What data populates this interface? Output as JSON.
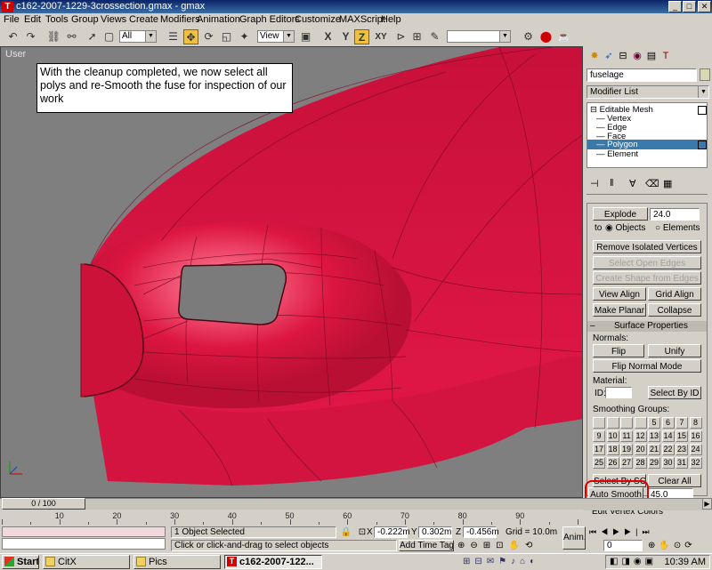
{
  "window": {
    "title": "c162-2007-1229-3crossection.gmax - gmax",
    "minimize": "_",
    "maximize": "□",
    "close": "✕"
  },
  "menu": [
    "File",
    "Edit",
    "Tools",
    "Group",
    "Views",
    "Create",
    "Modifiers",
    "Animation",
    "Graph Editors",
    "Customize",
    "MAXScript",
    "Help"
  ],
  "toolbar": {
    "selection_filter": "All",
    "ref_coord": "View",
    "axis_x": "X",
    "axis_y": "Y",
    "axis_z": "Z",
    "axis_xy": "XY"
  },
  "viewport": {
    "label": "User",
    "caption": "With the cleanup completed, we now select all polys and re-Smooth the fuse for inspection of our work",
    "model_color": "#e0163c"
  },
  "command_panel": {
    "object_name": "fuselage",
    "modifier_list": "Modifier List",
    "stack": {
      "root": "Editable Mesh",
      "items": [
        "Vertex",
        "Edge",
        "Face",
        "Polygon",
        "Element"
      ],
      "selected": "Polygon"
    },
    "explode_label": "Explode",
    "explode_value": "24.0",
    "to_label": "to",
    "objects_label": "Objects",
    "elements_label": "Elements",
    "remove_isolated": "Remove Isolated Vertices",
    "select_open_edges": "Select Open Edges",
    "create_shape": "Create Shape from Edges",
    "view_align": "View Align",
    "grid_align": "Grid Align",
    "make_planar": "Make Planar",
    "collapse": "Collapse",
    "surface_properties": "Surface Properties",
    "surface_collapse_sign": "–",
    "normals_label": "Normals:",
    "flip": "Flip",
    "unify": "Unify",
    "flip_normal_mode": "Flip Normal Mode",
    "material_label": "Material:",
    "id_label": "ID:",
    "select_by_id": "Select By ID",
    "smoothing_groups_label": "Smoothing Groups:",
    "smoothing_groups": [
      "",
      "",
      "",
      "",
      "5",
      "6",
      "7",
      "8",
      "9",
      "10",
      "11",
      "12",
      "13",
      "14",
      "15",
      "16",
      "17",
      "18",
      "19",
      "20",
      "21",
      "22",
      "23",
      "24",
      "25",
      "26",
      "27",
      "28",
      "29",
      "30",
      "31",
      "32"
    ],
    "select_by_sg": "Select By SG",
    "clear_all": "Clear All",
    "auto_smooth": "Auto Smooth",
    "auto_smooth_value": "45.0",
    "edit_vertex_colors": "Edit Vertex Colors",
    "highlight_color": "#e00000"
  },
  "timeline": {
    "frame": "0 / 100",
    "ticks": [
      "10",
      "20",
      "30",
      "40",
      "50",
      "60",
      "70",
      "80",
      "90"
    ]
  },
  "status": {
    "objects_selected": "1 Object Selected",
    "prompt": "Click or click-and-drag to select objects",
    "x_label": "X",
    "x_value": "-0.222m",
    "y_label": "Y",
    "y_value": "0.302m",
    "z_label": "Z",
    "z_value": "-0.456m",
    "grid": "Grid = 10.0m",
    "add_time_tag": "Add Time Tag",
    "anim": "Anim.",
    "frame_value": "0"
  },
  "taskbar": {
    "start": "Start",
    "tasks": [
      "CitX",
      "Pics",
      "c162-2007-122..."
    ],
    "clock": "10:39 AM"
  }
}
